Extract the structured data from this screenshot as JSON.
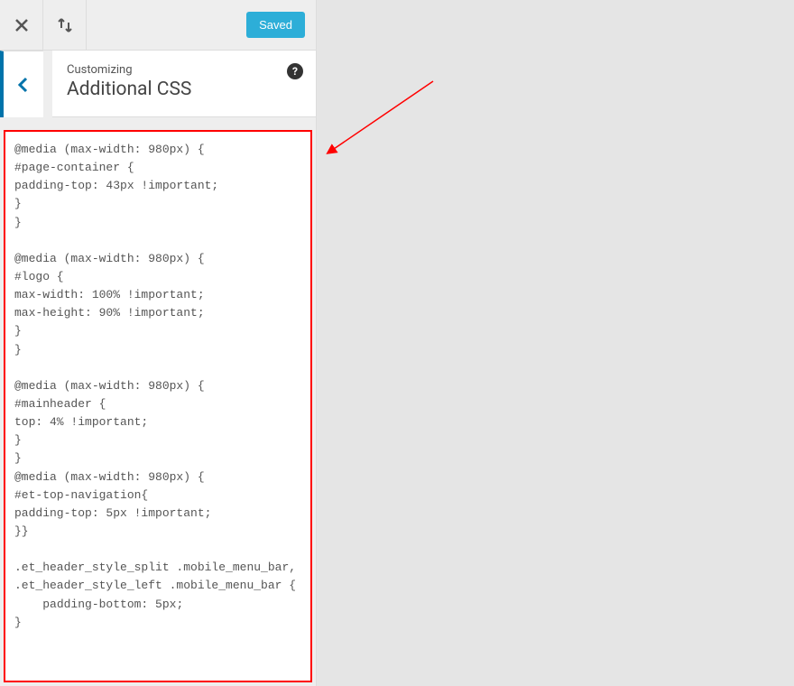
{
  "toolbar": {
    "saved_label": "Saved"
  },
  "header": {
    "customizing_label": "Customizing",
    "section_title": "Additional CSS",
    "help_symbol": "?"
  },
  "css_code": "@media (max-width: 980px) {\n#page-container {\npadding-top: 43px !important;\n}\n}\n\n@media (max-width: 980px) {\n#logo {\nmax-width: 100% !important;\nmax-height: 90% !important;\n}\n}\n\n@media (max-width: 980px) {\n#mainheader {\ntop: 4% !important;\n}\n}\n@media (max-width: 980px) {\n#et-top-navigation{\npadding-top: 5px !important;\n}}\n\n.et_header_style_split .mobile_menu_bar,\n.et_header_style_left .mobile_menu_bar {\n    padding-bottom: 5px;\n}",
  "colors": {
    "accent": "#0073aa",
    "saved_bg": "#19a8d6",
    "highlight_border": "#ff0000",
    "arrow": "#ff0000"
  }
}
